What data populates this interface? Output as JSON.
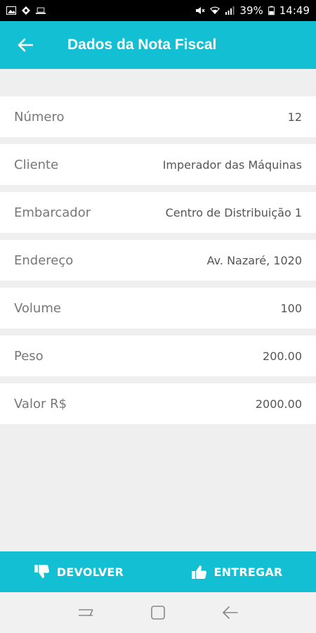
{
  "status": {
    "battery": "39%",
    "time": "14:49"
  },
  "header": {
    "title": "Dados da Nota Fiscal"
  },
  "details": [
    {
      "label": "Número",
      "value": "12"
    },
    {
      "label": "Cliente",
      "value": "Imperador das Máquinas"
    },
    {
      "label": "Embarcador",
      "value": "Centro de Distribuição 1"
    },
    {
      "label": "Endereço",
      "value": "Av. Nazaré, 1020"
    },
    {
      "label": "Volume",
      "value": "100"
    },
    {
      "label": "Peso",
      "value": "200.00"
    },
    {
      "label": "Valor R$",
      "value": "2000.00"
    }
  ],
  "actions": {
    "return_label": "DEVOLVER",
    "deliver_label": "ENTREGAR"
  },
  "colors": {
    "primary": "#13bfd2",
    "background": "#efefef"
  }
}
